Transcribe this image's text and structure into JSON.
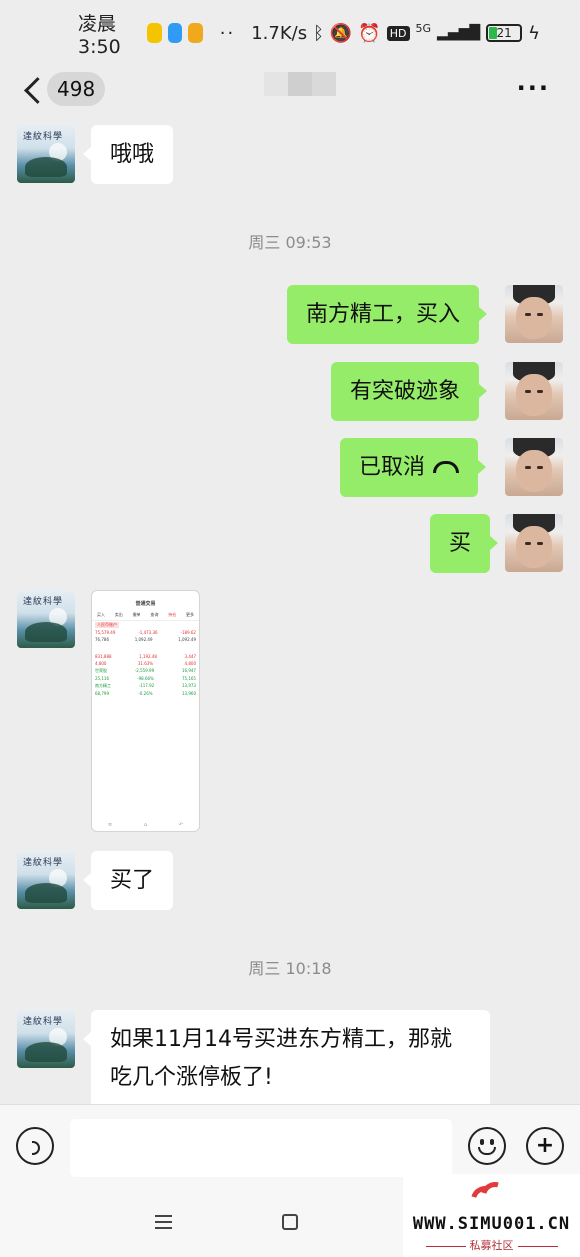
{
  "status_bar": {
    "time": "凌晨3:50",
    "more_dots": "··",
    "network_speed": "1.7K/s",
    "hd_label": "HD",
    "network_type": "5G",
    "battery_level": "21",
    "charging_icon": "bolt-icon"
  },
  "nav": {
    "unread_count": "498",
    "more_label": "···"
  },
  "messages": [
    {
      "side": "in",
      "text": "哦哦"
    },
    {
      "type": "time",
      "text": "周三 09:53"
    },
    {
      "side": "out",
      "text": "南方精工，买入"
    },
    {
      "side": "out",
      "text": "有突破迹象"
    },
    {
      "side": "out",
      "text": "已取消",
      "icon": "recalled-call-icon"
    },
    {
      "side": "out",
      "text": "买"
    },
    {
      "side": "in",
      "type": "image"
    },
    {
      "side": "in",
      "text": "买了"
    },
    {
      "type": "time",
      "text": "周三 10:18"
    },
    {
      "side": "in",
      "text": "如果11月14号买进东方精工，那就吃几个涨停板了!"
    }
  ],
  "avatar_left_caption": "達紋科學",
  "screenshot": {
    "title": "普通交易",
    "tabs": [
      "买入",
      "卖出",
      "撤单",
      "查询",
      "持仓",
      "更多"
    ],
    "account": "人民币账户",
    "rows": [
      {
        "a": "75,579.49",
        "b": "-1,473.36",
        "c": "-189.62",
        "cls": "red"
      },
      {
        "a": "76,786",
        "b": "1,092.49",
        "c": "1,092.49",
        "cls": ""
      },
      {
        "a": "831,888",
        "b": "1,192.48",
        "c": "3,447",
        "cls": "red"
      },
      {
        "a": "4,800",
        "b": "31.63%",
        "c": "4,800",
        "cls": "red"
      },
      {
        "a": "世荣股",
        "b": "-2,559.99",
        "c": "16,947",
        "cls": "green"
      },
      {
        "a": "25,116",
        "b": "-98.66%",
        "c": "75,165",
        "cls": "green"
      },
      {
        "a": "南方精工",
        "b": "-117.92",
        "c": "13,973",
        "cls": "green"
      },
      {
        "a": "68,799",
        "b": "-0.26%",
        "c": "13,960",
        "cls": "green"
      }
    ],
    "bottom": [
      "≡",
      "⌂",
      "↶"
    ]
  },
  "input_bar": {
    "voice_icon": "voice-icon",
    "emoji_icon": "emoji-icon",
    "plus_label": "+"
  },
  "watermark": {
    "url": "WWW.SIMU001.CN",
    "cn": "私募社区"
  },
  "colors": {
    "bubble_out": "#95ec69",
    "bubble_in": "#ffffff",
    "background": "#ededed"
  }
}
